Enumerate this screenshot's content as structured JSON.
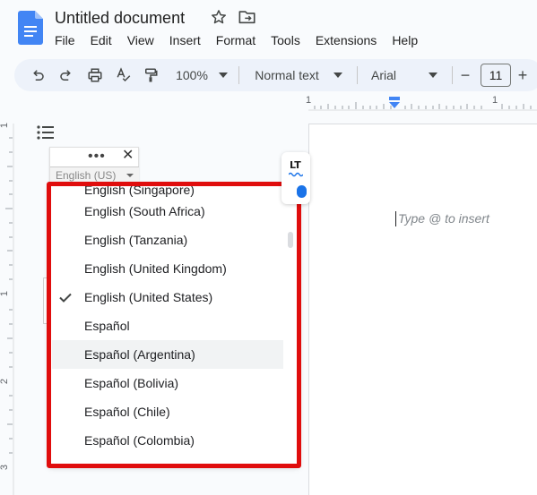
{
  "doc": {
    "title": "Untitled document"
  },
  "menu": [
    "File",
    "Edit",
    "View",
    "Insert",
    "Format",
    "Tools",
    "Extensions",
    "Help"
  ],
  "toolbar": {
    "zoom": "100%",
    "style": "Normal text",
    "font": "Arial",
    "font_size": "11",
    "minus": "−",
    "plus": "+"
  },
  "ruler": {
    "h_ticks": [
      "1",
      "1"
    ],
    "v_ticks": [
      "1",
      "1",
      "2",
      "3"
    ]
  },
  "language_panel": {
    "current": "English (US)",
    "dots": "•••",
    "close": "✕",
    "items": [
      "English (South Africa)",
      "English (Tanzania)",
      "English (United Kingdom)",
      "English (United States)",
      "Español",
      "Español (Argentina)",
      "Español (Bolivia)",
      "Español (Chile)",
      "Español (Colombia)"
    ],
    "checked_item": "English (United States)",
    "hovered_item": "Español (Argentina)"
  },
  "page": {
    "placeholder": "Type @ to insert"
  },
  "languagetool": {
    "label": "LT"
  },
  "colors": {
    "highlight_frame": "#e00d0d",
    "brand_blue": "#1a73e8",
    "toolbar_bg": "#edf2fa"
  }
}
